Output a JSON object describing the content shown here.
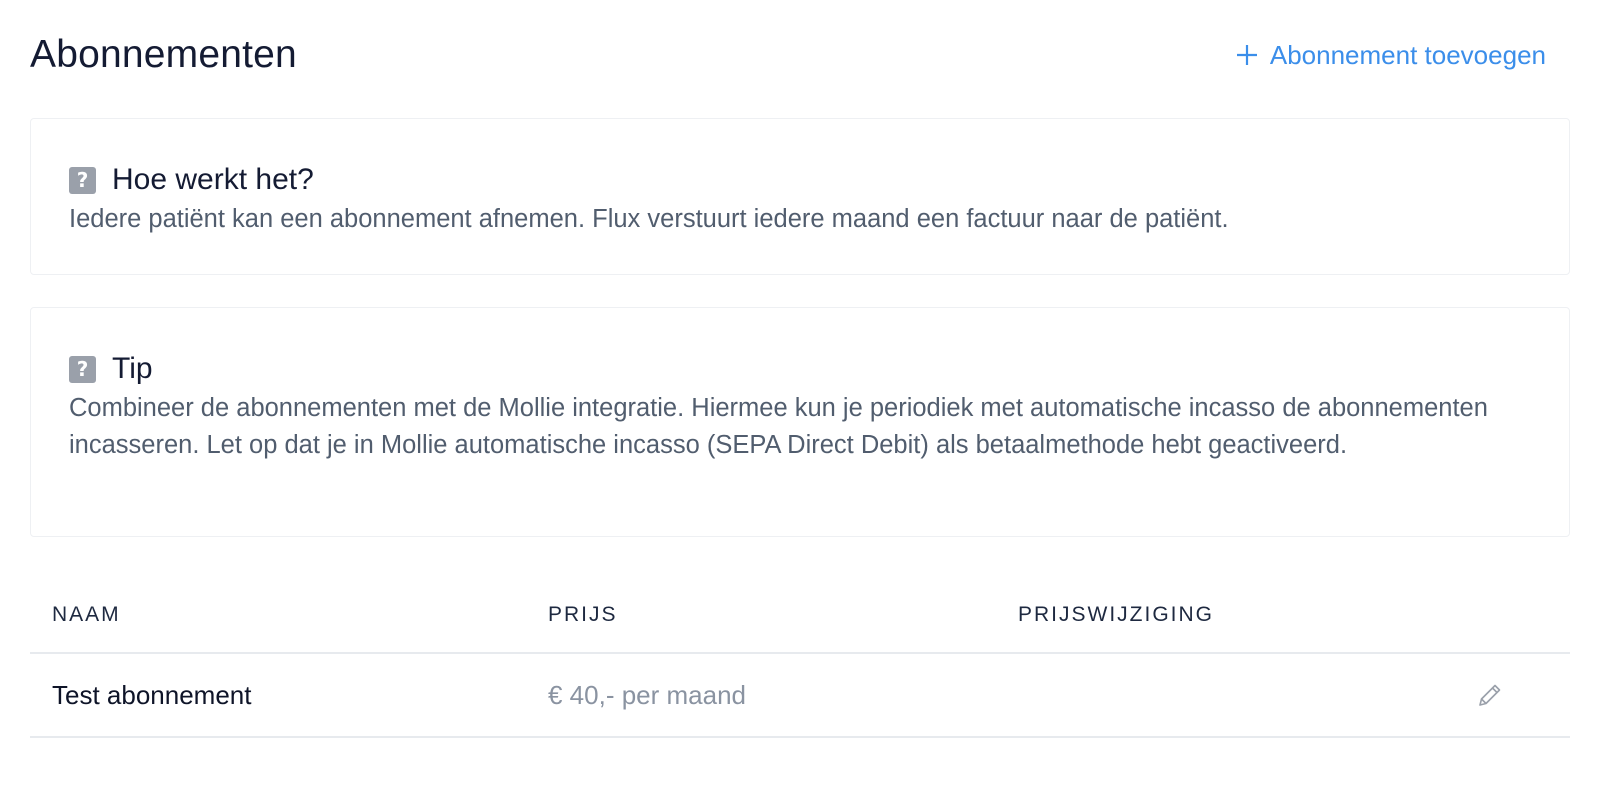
{
  "header": {
    "title": "Abonnementen",
    "add_label": "Abonnement toevoegen"
  },
  "info_how": {
    "title": "Hoe werkt het?",
    "text": "Iedere patiënt kan een abonnement afnemen. Flux verstuurt iedere maand een factuur naar de patiënt."
  },
  "info_tip": {
    "title": "Tip",
    "text": "Combineer de abonnementen met de Mollie integratie. Hiermee kun je periodiek met automatische incasso de abonnementen incasseren. Let op dat je in Mollie automatische incasso (SEPA Direct Debit) als betaalmethode hebt geactiveerd."
  },
  "table": {
    "columns": [
      "NAAM",
      "PRIJS",
      "PRIJSWIJZIGING"
    ],
    "rows": [
      {
        "name": "Test abonnement",
        "price": "€ 40,- per maand",
        "price_change": ""
      }
    ]
  },
  "icons": {
    "add": "plus-icon",
    "help": "question-icon",
    "edit": "pencil-icon"
  },
  "colors": {
    "accent": "#3b8eea",
    "help_icon_bg": "#9aa0aa",
    "text_muted": "#515d6e",
    "price_text": "#8a93a1"
  }
}
